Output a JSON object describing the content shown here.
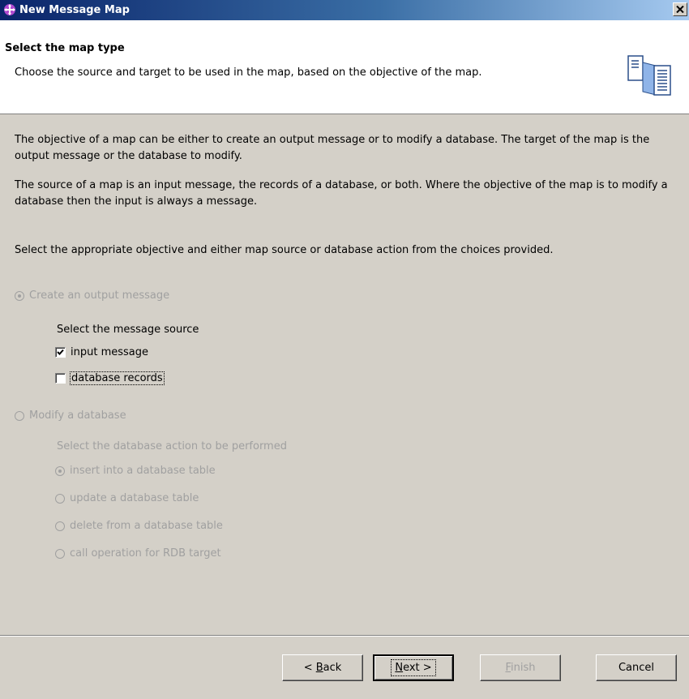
{
  "window": {
    "title": "New Message Map",
    "close_glyph": "×"
  },
  "header": {
    "title": "Select the map type",
    "description": "Choose the source and target to be used in the map, based on the objective of the map.",
    "graphic": "map-wizard-graphic"
  },
  "body": {
    "paragraph1": "The objective of a map can be either to create an output message or to modify a database. The target of the map is the output message or the database to modify.",
    "paragraph2": "The source of a map is an input message, the records of a database, or both. Where the objective of the map is to modify a database then the input is always a message.",
    "paragraph3": "Select the appropriate objective and either map source or database action from the choices provided."
  },
  "objective_create": {
    "label": "Create an output message",
    "selected": true,
    "enabled": false
  },
  "message_source": {
    "label": "Select the message source",
    "options": [
      {
        "label": "input message",
        "checked": true
      },
      {
        "label": "database records",
        "checked": false
      }
    ]
  },
  "objective_modify": {
    "label": "Modify a database",
    "selected": false,
    "enabled": false
  },
  "database_action": {
    "label": "Select the database action to be performed",
    "options": [
      {
        "label": "insert into a database table",
        "selected": true
      },
      {
        "label": "update a database table",
        "selected": false
      },
      {
        "label": "delete from a database table",
        "selected": false
      },
      {
        "label": "call operation for RDB target",
        "selected": false
      }
    ]
  },
  "buttons": {
    "back": {
      "prefix": "< ",
      "mnemonic": "B",
      "rest": "ack"
    },
    "next": {
      "mnemonic": "N",
      "rest": "ext >"
    },
    "finish": {
      "mnemonic": "F",
      "rest": "inish"
    },
    "cancel": "Cancel"
  }
}
